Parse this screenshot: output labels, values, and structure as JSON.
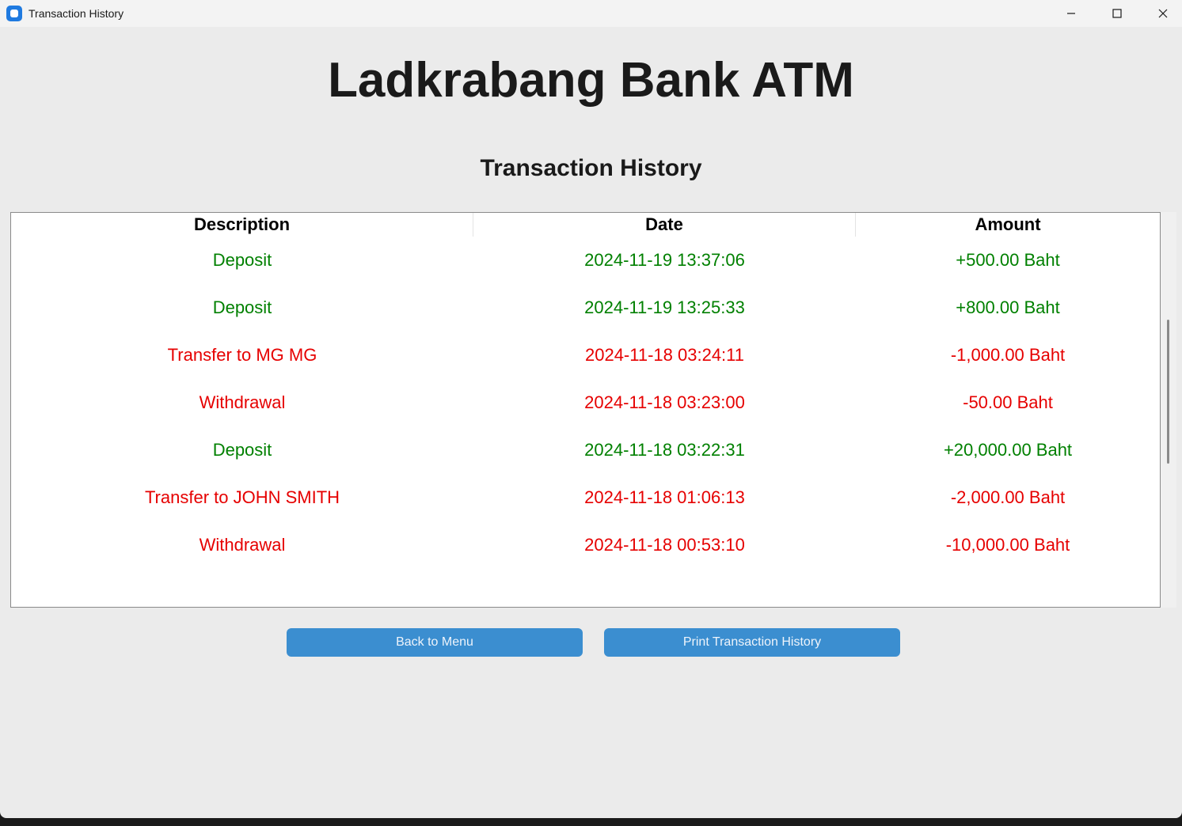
{
  "window": {
    "title": "Transaction History"
  },
  "header": {
    "bank_name": "Ladkrabang Bank ATM",
    "section_title": "Transaction History"
  },
  "table": {
    "columns": [
      "Description",
      "Date",
      "Amount"
    ],
    "rows": [
      {
        "description": "Deposit",
        "date": "2024-11-19 13:37:06",
        "amount": "+500.00 Baht",
        "type": "credit"
      },
      {
        "description": "Deposit",
        "date": "2024-11-19 13:25:33",
        "amount": "+800.00 Baht",
        "type": "credit"
      },
      {
        "description": "Transfer to MG MG",
        "date": "2024-11-18 03:24:11",
        "amount": "-1,000.00 Baht",
        "type": "debit"
      },
      {
        "description": "Withdrawal",
        "date": "2024-11-18 03:23:00",
        "amount": "-50.00 Baht",
        "type": "debit"
      },
      {
        "description": "Deposit",
        "date": "2024-11-18 03:22:31",
        "amount": "+20,000.00 Baht",
        "type": "credit"
      },
      {
        "description": "Transfer to JOHN SMITH",
        "date": "2024-11-18 01:06:13",
        "amount": "-2,000.00 Baht",
        "type": "debit"
      },
      {
        "description": "Withdrawal",
        "date": "2024-11-18 00:53:10",
        "amount": "-10,000.00 Baht",
        "type": "debit"
      }
    ]
  },
  "buttons": {
    "back": "Back to Menu",
    "print": "Print Transaction History"
  },
  "colors": {
    "credit": "#008000",
    "debit": "#e60000",
    "button": "#3b8ed0"
  },
  "icons": {
    "app": "app-icon",
    "minimize": "minimize-icon",
    "maximize": "maximize-icon",
    "close": "close-icon"
  }
}
